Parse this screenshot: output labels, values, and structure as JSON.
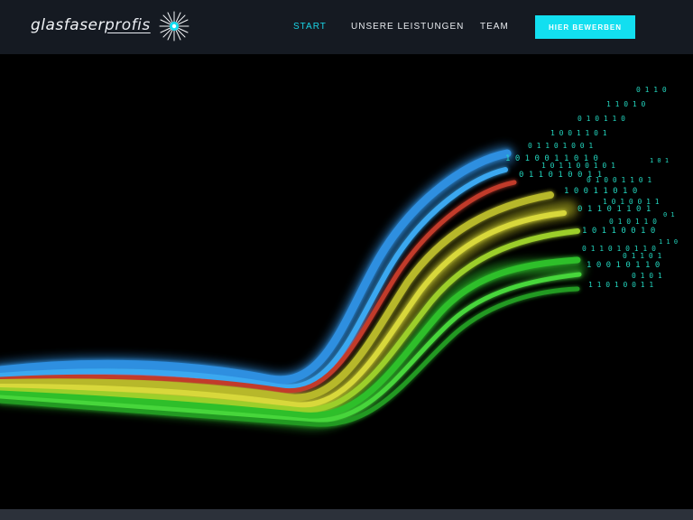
{
  "brand": {
    "logo_text_main": "glasfaser",
    "logo_text_sub": "profis",
    "icon": "starburst-icon"
  },
  "nav": {
    "items": [
      {
        "label": "START",
        "active": true
      },
      {
        "label": "UNSERE LEISTUNGEN",
        "active": false
      },
      {
        "label": "TEAM",
        "active": false
      }
    ],
    "cta_label": "HIER BEWERBEN"
  },
  "colors": {
    "header_bg": "#151a22",
    "accent": "#12dff0",
    "hero_bg": "#000000",
    "fiber_blue": "#2f8fe0",
    "fiber_yellow": "#c9c928",
    "fiber_green": "#2fbf2a",
    "fiber_red": "#c23a2a",
    "data_cyan": "#25e0c8"
  },
  "hero": {
    "image": "fiber-optic-cables-illustration"
  }
}
